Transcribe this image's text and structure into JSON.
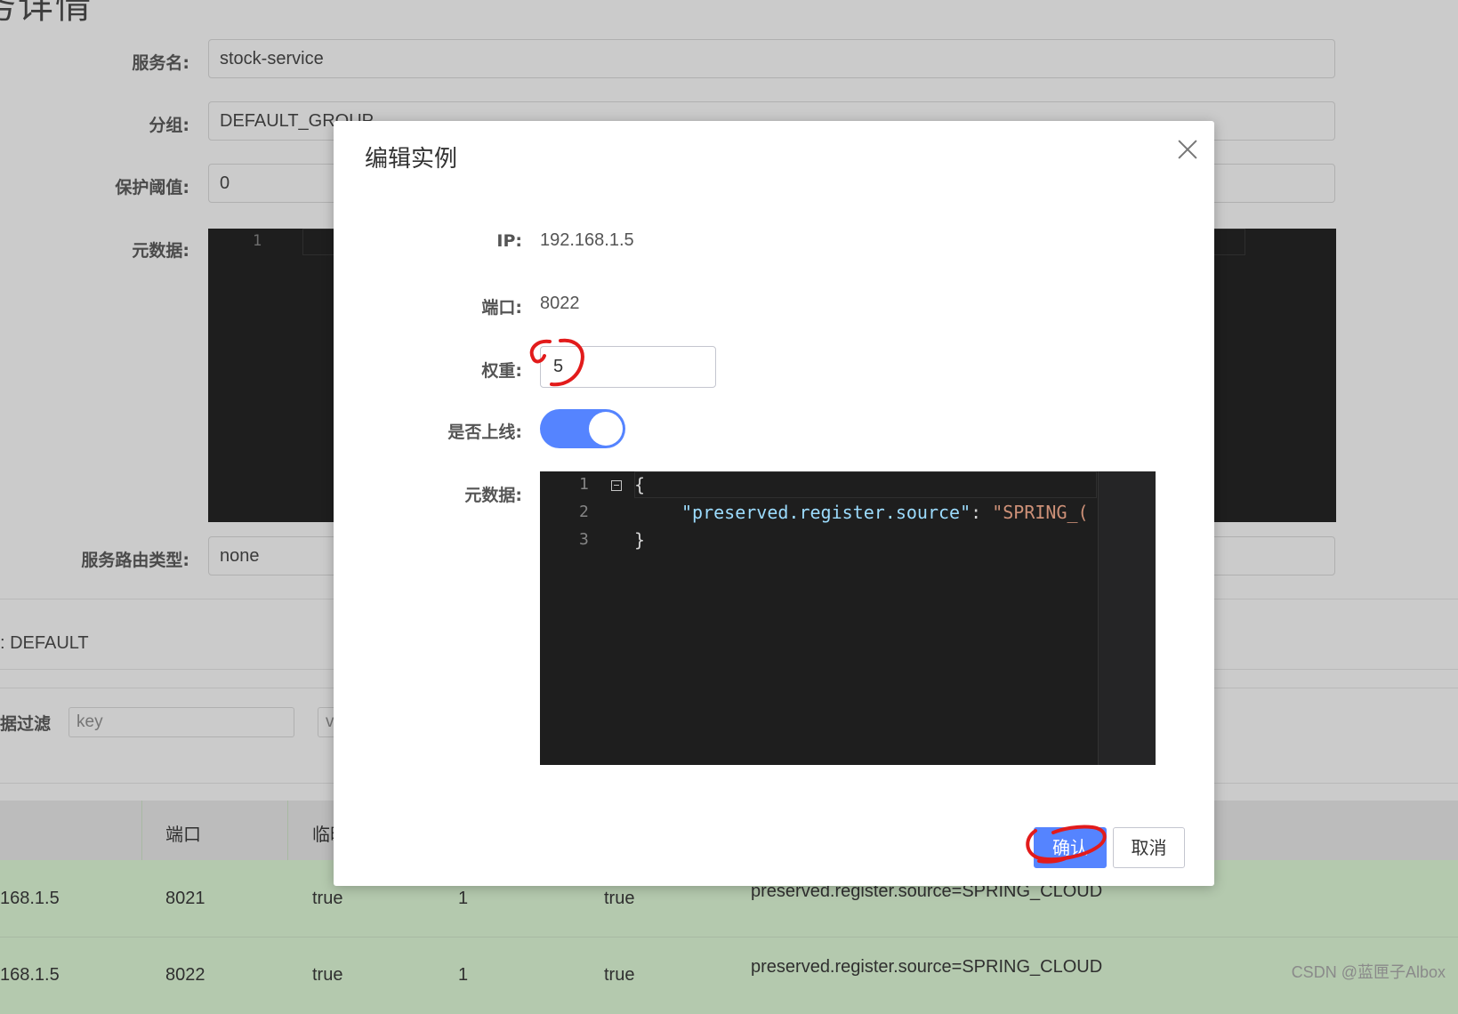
{
  "page": {
    "title_fragment": "务详情",
    "fields": [
      {
        "label": "服务名:",
        "value": "stock-service"
      },
      {
        "label": "分组:",
        "value": "DEFAULT_GROUP"
      },
      {
        "label": "保护阈值:",
        "value": "0"
      },
      {
        "label": "元数据:",
        "value": ""
      },
      {
        "label": "服务路由类型:",
        "value": "none"
      }
    ],
    "metadata_editor_line": "1",
    "cluster_label": ": DEFAULT",
    "filter_label": "据过滤",
    "filter_key_placeholder": "key",
    "filter_value_placeholder": "v"
  },
  "table": {
    "headers": [
      "",
      "端口",
      "临时",
      "",
      "",
      ""
    ],
    "rows": [
      [
        "168.1.5",
        "8021",
        "true",
        "1",
        "true",
        "preserved.register.source=SPRING_CLOUD"
      ],
      [
        "168.1.5",
        "8022",
        "true",
        "1",
        "true",
        "preserved.register.source=SPRING_CLOUD"
      ]
    ]
  },
  "modal": {
    "title": "编辑实例",
    "ip_label": "IP:",
    "ip_value": "192.168.1.5",
    "port_label": "端口:",
    "port_value": "8022",
    "weight_label": "权重:",
    "weight_value": "5",
    "online_label": "是否上线:",
    "online": true,
    "metadata_label": "元数据:",
    "code_lines": [
      "1",
      "2",
      "3"
    ],
    "code_open": "{",
    "code_key": "\"preserved.register.source\"",
    "code_colon": ": ",
    "code_value": "\"SPRING_(",
    "code_close": "}",
    "confirm_label": "确认",
    "cancel_label": "取消"
  },
  "watermark": "CSDN @蓝匣子Albox",
  "colors": {
    "accent": "#5584ff",
    "annotation": "#e21b1b",
    "row_green": "#b4c9ae"
  }
}
